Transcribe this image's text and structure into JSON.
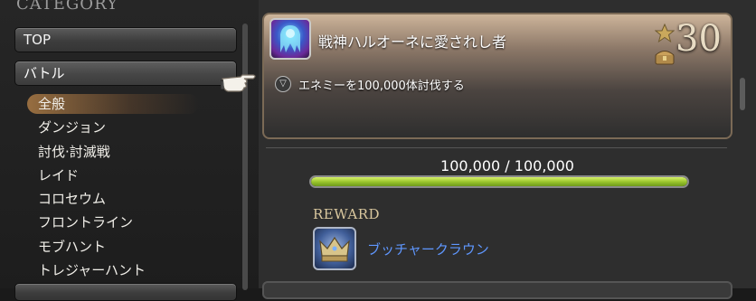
{
  "sidebar": {
    "header": "CATEGORY",
    "top_button": "TOP",
    "battle_button": "バトル",
    "items": [
      {
        "label": "全般"
      },
      {
        "label": "ダンジョン"
      },
      {
        "label": "討伐·討滅戦"
      },
      {
        "label": "レイド"
      },
      {
        "label": "コロセウム"
      },
      {
        "label": "フロントライン"
      },
      {
        "label": "モブハント"
      },
      {
        "label": "トレジャーハント"
      }
    ],
    "selected_index": 0
  },
  "achievement": {
    "name": "戦神ハルオーネに愛されし者",
    "points": "30",
    "description": "エネミーを100,000体討伐する",
    "progress_text": "100,000 / 100,000",
    "progress_fraction": 1.0,
    "reward_label": "REWARD",
    "reward_name": "ブッチャークラウン"
  },
  "colors": {
    "progress_fill": "#9cc72e",
    "reward_link": "#5f97ff",
    "selected_highlight": "#d69650"
  },
  "icons": {
    "pointer": "pointing-hand-icon",
    "achievement": "achievement-icon",
    "points_star": "star-icon",
    "points_chest": "treasure-chest-icon",
    "description": "chevron-down-icon",
    "reward": "crown-icon"
  }
}
